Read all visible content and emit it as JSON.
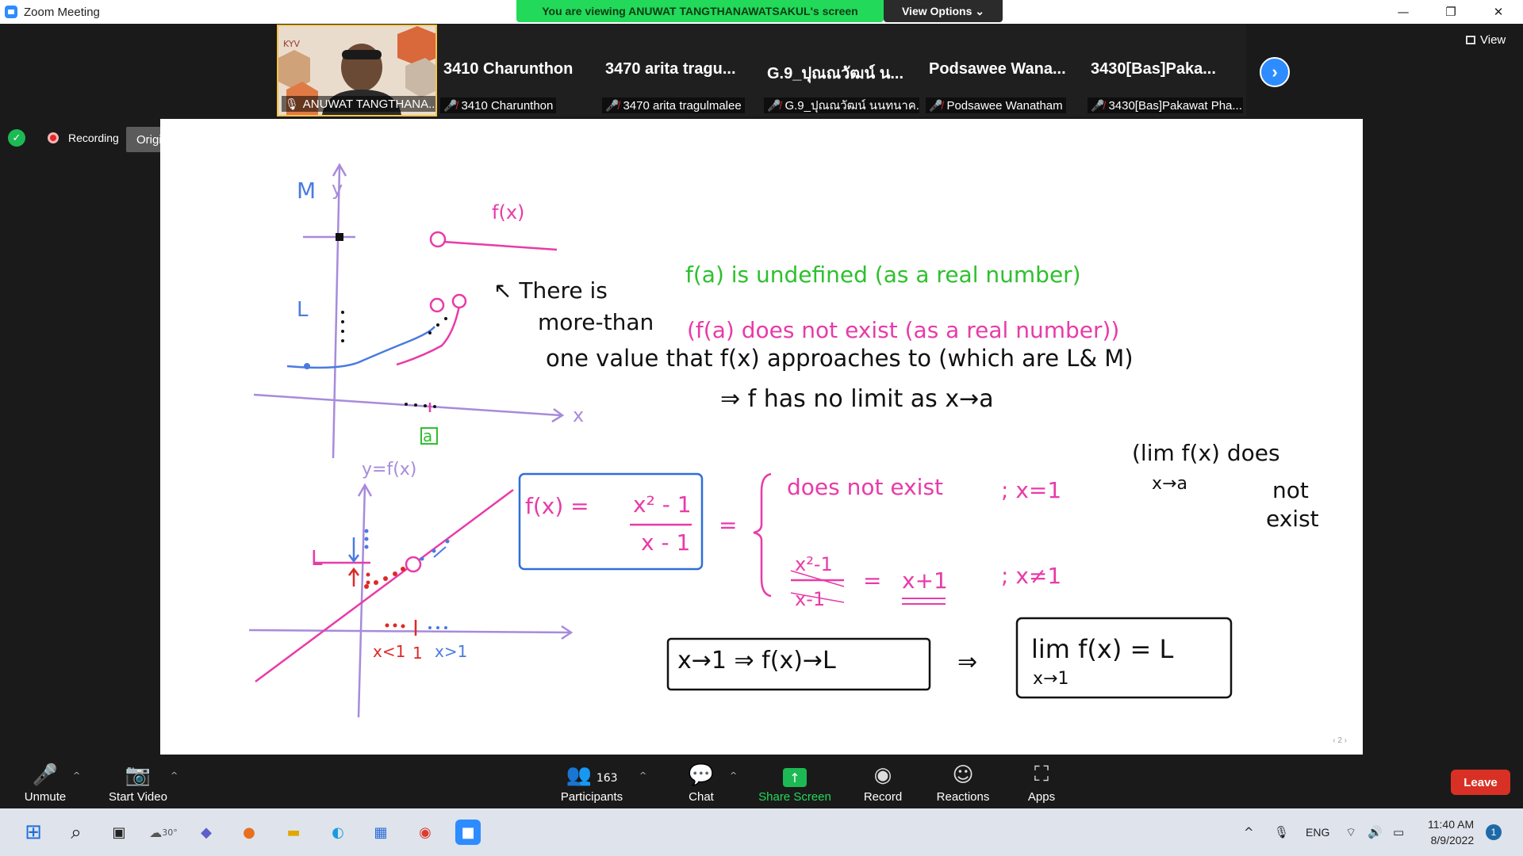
{
  "window": {
    "title": "Zoom Meeting"
  },
  "banner": {
    "viewing_text": "You are viewing ANUWAT TANGTHANAWATSAKUL's screen",
    "view_options": "View Options ⌄"
  },
  "gallery": {
    "tiles": [
      {
        "big": "",
        "small": "ANUWAT TANGTHANA..."
      },
      {
        "big": "3410 Charunthon",
        "small": "3410 Charunthon"
      },
      {
        "big": "3470 arita tragu...",
        "small": "3470 arita tragulmalee"
      },
      {
        "big": "G.9_ปุณณวัฒน์ น...",
        "small": "G.9_ปุณณวัฒน์ นนทนาค..."
      },
      {
        "big": "Podsawee  Wana...",
        "small": "Podsawee Wanatham"
      },
      {
        "big": "3430[Bas]Paka...",
        "small": "3430[Bas]Pakawat Pha..."
      }
    ],
    "view_label": "View"
  },
  "recording": {
    "label": "Recording",
    "original_sound": "Original Sound: Off"
  },
  "whiteboard": {
    "top_graph": {
      "y": "y",
      "x": "x",
      "M": "M",
      "L": "L",
      "fx": "f(x)",
      "a": "a"
    },
    "note_lines": [
      "↖ There is",
      "more-than",
      "one value that f(x) approaches to  (which are  L& M)"
    ],
    "green_line1": "f(a)  is undefined  (as a  real number)",
    "green_line2": "(f(a)  does  not  exist  (as a real  number))",
    "conclusion": "⇒   f  has  no limit  as  x→a",
    "lim_note": [
      "(lim f(x)  does",
      "x→a",
      "not",
      "exist"
    ],
    "bottom_graph": {
      "yfx": "y=f(x)",
      "L": "L",
      "xlt": "x<1",
      "one": "1",
      "xgt": "x>1"
    },
    "fx_box": {
      "lhs": "f(x) =",
      "num": "x² - 1",
      "den": "x - 1"
    },
    "eq": "=",
    "case1": {
      "text": "does  not  exist",
      "cond": "; x=1"
    },
    "case2": {
      "num": "x²-1",
      "den": "x-1",
      "eq": "=",
      "rhs": "x+1",
      "cond": "; x≠1"
    },
    "box_left": "x→1  ⇒  f(x)→L",
    "implies": "⇒",
    "box_right_top": "lim  f(x)  = L",
    "box_right_sub": "x→1",
    "pager": "‹  2  ›"
  },
  "toolbar": {
    "unmute": "Unmute",
    "start_video": "Start Video",
    "participants": "Participants",
    "participant_count": "163",
    "chat": "Chat",
    "share": "Share Screen",
    "record": "Record",
    "reactions": "Reactions",
    "apps": "Apps",
    "leave": "Leave"
  },
  "taskbar": {
    "weather": "30°",
    "lang": "ENG",
    "time": "11:40 AM",
    "date": "8/9/2022",
    "notifications": "1"
  },
  "colors": {
    "accent": "#2d8cff",
    "share_green": "#23d959",
    "leave_red": "#d93025"
  }
}
